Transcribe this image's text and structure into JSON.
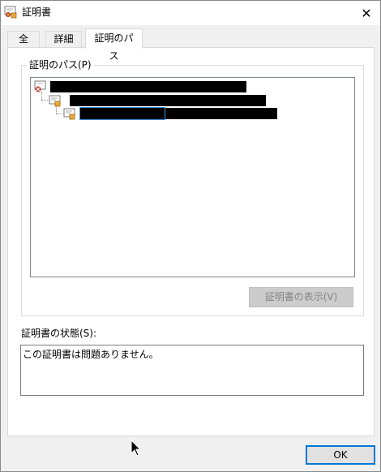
{
  "window": {
    "title": "証明書",
    "app_icon": "certificate-icon",
    "close_glyph": "✕"
  },
  "tabs": [
    {
      "label": "全般",
      "active": false
    },
    {
      "label": "詳細",
      "active": false
    },
    {
      "label": "証明のパス",
      "active": true
    }
  ],
  "path_group": {
    "label": "証明のパス(P)",
    "tree": [
      {
        "level": 0,
        "icon": "root-certificate-icon",
        "text": ""
      },
      {
        "level": 1,
        "icon": "certificate-icon",
        "text": ""
      },
      {
        "level": 2,
        "icon": "certificate-icon",
        "text": "",
        "selected": true
      }
    ],
    "view_button": "証明書の表示(V)"
  },
  "status": {
    "label": "証明書の状態(S):",
    "value": "この証明書は問題ありません。"
  },
  "footer": {
    "ok_label": "OK"
  },
  "colors": {
    "focus_blue": "#0078d7",
    "selection_outline": "#3c8dd8",
    "redaction": "#000000"
  }
}
